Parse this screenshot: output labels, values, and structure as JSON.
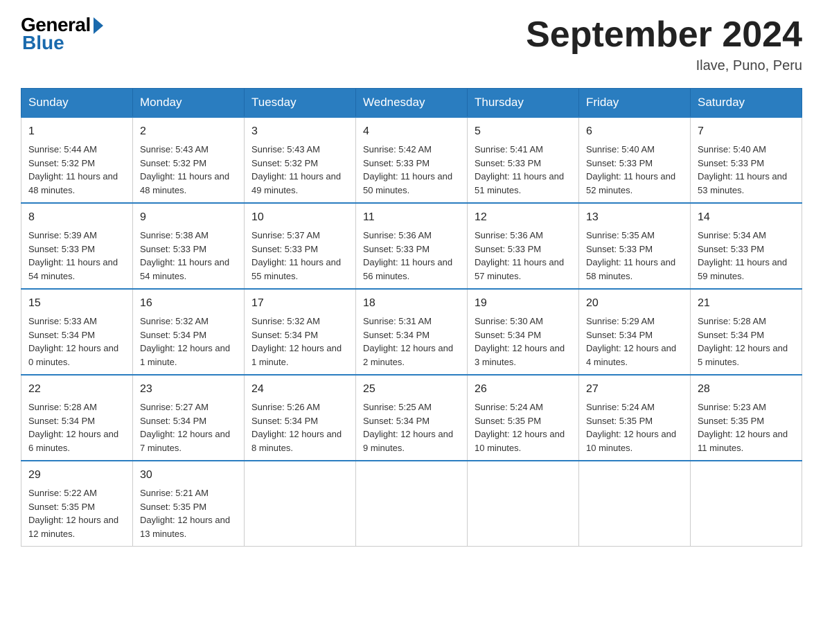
{
  "logo": {
    "general": "General",
    "blue": "Blue"
  },
  "title": "September 2024",
  "location": "Ilave, Puno, Peru",
  "days_of_week": [
    "Sunday",
    "Monday",
    "Tuesday",
    "Wednesday",
    "Thursday",
    "Friday",
    "Saturday"
  ],
  "weeks": [
    [
      {
        "day": "1",
        "sunrise": "5:44 AM",
        "sunset": "5:32 PM",
        "daylight": "11 hours and 48 minutes."
      },
      {
        "day": "2",
        "sunrise": "5:43 AM",
        "sunset": "5:32 PM",
        "daylight": "11 hours and 48 minutes."
      },
      {
        "day": "3",
        "sunrise": "5:43 AM",
        "sunset": "5:32 PM",
        "daylight": "11 hours and 49 minutes."
      },
      {
        "day": "4",
        "sunrise": "5:42 AM",
        "sunset": "5:33 PM",
        "daylight": "11 hours and 50 minutes."
      },
      {
        "day": "5",
        "sunrise": "5:41 AM",
        "sunset": "5:33 PM",
        "daylight": "11 hours and 51 minutes."
      },
      {
        "day": "6",
        "sunrise": "5:40 AM",
        "sunset": "5:33 PM",
        "daylight": "11 hours and 52 minutes."
      },
      {
        "day": "7",
        "sunrise": "5:40 AM",
        "sunset": "5:33 PM",
        "daylight": "11 hours and 53 minutes."
      }
    ],
    [
      {
        "day": "8",
        "sunrise": "5:39 AM",
        "sunset": "5:33 PM",
        "daylight": "11 hours and 54 minutes."
      },
      {
        "day": "9",
        "sunrise": "5:38 AM",
        "sunset": "5:33 PM",
        "daylight": "11 hours and 54 minutes."
      },
      {
        "day": "10",
        "sunrise": "5:37 AM",
        "sunset": "5:33 PM",
        "daylight": "11 hours and 55 minutes."
      },
      {
        "day": "11",
        "sunrise": "5:36 AM",
        "sunset": "5:33 PM",
        "daylight": "11 hours and 56 minutes."
      },
      {
        "day": "12",
        "sunrise": "5:36 AM",
        "sunset": "5:33 PM",
        "daylight": "11 hours and 57 minutes."
      },
      {
        "day": "13",
        "sunrise": "5:35 AM",
        "sunset": "5:33 PM",
        "daylight": "11 hours and 58 minutes."
      },
      {
        "day": "14",
        "sunrise": "5:34 AM",
        "sunset": "5:33 PM",
        "daylight": "11 hours and 59 minutes."
      }
    ],
    [
      {
        "day": "15",
        "sunrise": "5:33 AM",
        "sunset": "5:34 PM",
        "daylight": "12 hours and 0 minutes."
      },
      {
        "day": "16",
        "sunrise": "5:32 AM",
        "sunset": "5:34 PM",
        "daylight": "12 hours and 1 minute."
      },
      {
        "day": "17",
        "sunrise": "5:32 AM",
        "sunset": "5:34 PM",
        "daylight": "12 hours and 1 minute."
      },
      {
        "day": "18",
        "sunrise": "5:31 AM",
        "sunset": "5:34 PM",
        "daylight": "12 hours and 2 minutes."
      },
      {
        "day": "19",
        "sunrise": "5:30 AM",
        "sunset": "5:34 PM",
        "daylight": "12 hours and 3 minutes."
      },
      {
        "day": "20",
        "sunrise": "5:29 AM",
        "sunset": "5:34 PM",
        "daylight": "12 hours and 4 minutes."
      },
      {
        "day": "21",
        "sunrise": "5:28 AM",
        "sunset": "5:34 PM",
        "daylight": "12 hours and 5 minutes."
      }
    ],
    [
      {
        "day": "22",
        "sunrise": "5:28 AM",
        "sunset": "5:34 PM",
        "daylight": "12 hours and 6 minutes."
      },
      {
        "day": "23",
        "sunrise": "5:27 AM",
        "sunset": "5:34 PM",
        "daylight": "12 hours and 7 minutes."
      },
      {
        "day": "24",
        "sunrise": "5:26 AM",
        "sunset": "5:34 PM",
        "daylight": "12 hours and 8 minutes."
      },
      {
        "day": "25",
        "sunrise": "5:25 AM",
        "sunset": "5:34 PM",
        "daylight": "12 hours and 9 minutes."
      },
      {
        "day": "26",
        "sunrise": "5:24 AM",
        "sunset": "5:35 PM",
        "daylight": "12 hours and 10 minutes."
      },
      {
        "day": "27",
        "sunrise": "5:24 AM",
        "sunset": "5:35 PM",
        "daylight": "12 hours and 10 minutes."
      },
      {
        "day": "28",
        "sunrise": "5:23 AM",
        "sunset": "5:35 PM",
        "daylight": "12 hours and 11 minutes."
      }
    ],
    [
      {
        "day": "29",
        "sunrise": "5:22 AM",
        "sunset": "5:35 PM",
        "daylight": "12 hours and 12 minutes."
      },
      {
        "day": "30",
        "sunrise": "5:21 AM",
        "sunset": "5:35 PM",
        "daylight": "12 hours and 13 minutes."
      },
      null,
      null,
      null,
      null,
      null
    ]
  ],
  "labels": {
    "sunrise": "Sunrise:",
    "sunset": "Sunset:",
    "daylight": "Daylight:"
  }
}
